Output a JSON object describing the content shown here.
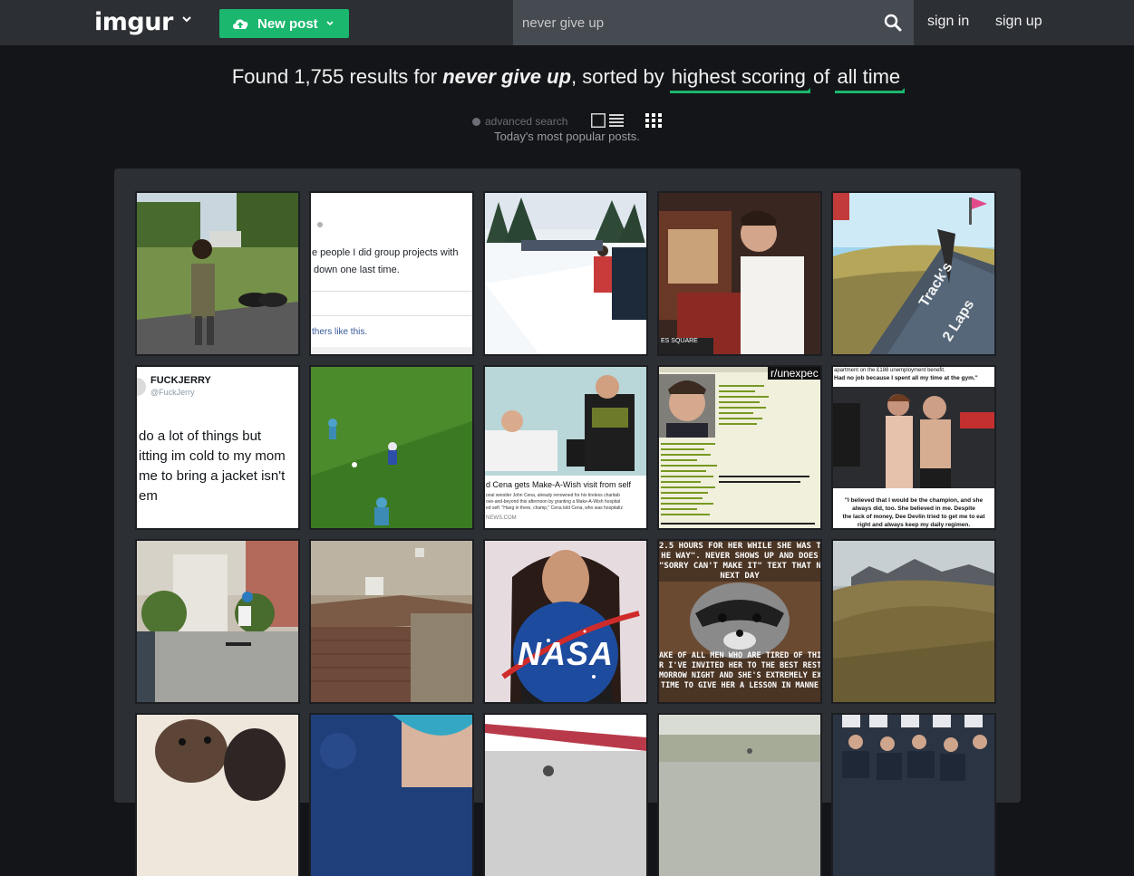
{
  "header": {
    "logo": "imgur",
    "new_post_label": "New post",
    "search_value": "never give up",
    "sign_in": "sign in",
    "sign_up": "sign up"
  },
  "results": {
    "prefix": "Found 1,755 results for",
    "query": "never give up",
    "sorted_by_text": ", sorted by",
    "sort": "highest scoring",
    "of_text": "of",
    "time_range": "all time",
    "advanced_search": "advanced search",
    "subtitle": "Today's most popular posts."
  },
  "tiles": {
    "t2_line1": "e people I did group projects with",
    "t2_line2": "down one last time.",
    "t2_footer": "thers like this.",
    "t4_tag": "ES SQUARE",
    "t5_sign_1": "Track's",
    "t5_sign_2": "2 Laps",
    "t6_name": "FUCKJERRY",
    "t6_handle": "@FuckJerry",
    "t6_l1": "do a lot of things but",
    "t6_l2": "itting im cold to my mom",
    "t6_l3": "me to bring a jacket isn't",
    "t6_l4": "em",
    "t8_headline": "d Cena gets Make-A-Wish visit from self",
    "t8_body1": "onal wrestler John Cena, already renowned for his tireless charitab",
    "t8_body2": "ove-and-beyond this afternoon by granting a Make-A-Wish hospital",
    "t8_body3": "ed self. \"Hang in there, champ,\" Cena told Cena, who was hospitaliz",
    "t8_source": "NEWS.COM",
    "t9_sub": "r/unexpec",
    "t10_top1": "apartment on the £188 unemployment benefit.",
    "t10_top2": "Had no job because I spent all my time at the gym.\"",
    "t10_bot1": "\"I believed that I would be the champion, and she",
    "t10_bot2": "always did, too. She believed in me. Despite",
    "t10_bot3": "the lack of money, Dee Devlin tried to get me to eat",
    "t10_bot4": "right and always keep my daily regimen.",
    "t13_logo": "NASA",
    "t14_top1": "2.5 HOURS FOR HER WHILE SHE WAS T",
    "t14_top2": "HE WAY\". NEVER SHOWS UP AND DOES",
    "t14_top3": "\"SORRY CAN'T MAKE IT\" TEXT THAT NI",
    "t14_top4": "NEXT DAY",
    "t14_bot1": "AKE OF ALL MEN WHO ARE TIRED OF THIS",
    "t14_bot2": "R I'VE INVITED HER TO THE BEST RESTAU",
    "t14_bot3": "MORROW NIGHT AND SHE'S EXTREMELY EX",
    "t14_bot4": "TIME TO GIVE HER A LESSON IN MANNE"
  },
  "colors": {
    "brand_green": "#1bb76e",
    "topbar": "#2c2f34",
    "background": "#141518",
    "search_bg": "#464b52"
  },
  "icons": [
    "chevron-down-icon",
    "cloud-upload-icon",
    "search-icon",
    "list-view-icon",
    "grid-view-icon"
  ]
}
